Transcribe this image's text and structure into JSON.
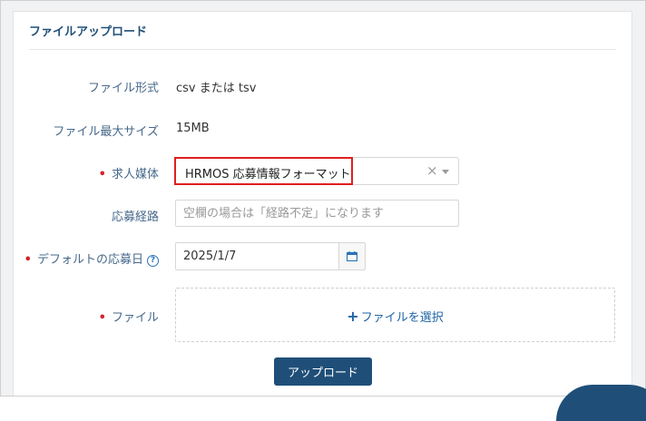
{
  "panel": {
    "title": "ファイルアップロード"
  },
  "fields": {
    "file_format": {
      "label": "ファイル形式",
      "value": "csv または tsv"
    },
    "max_size": {
      "label": "ファイル最大サイズ",
      "value": "15MB"
    },
    "media": {
      "required_mark": "•",
      "label": "求人媒体",
      "selected": "HRMOS 応募情報フォーマット",
      "clear_glyph": "×"
    },
    "route": {
      "label": "応募経路",
      "placeholder": "空欄の場合は「経路不定」になります"
    },
    "default_date": {
      "required_mark": "•",
      "label": "デフォルトの応募日",
      "value": "2025/1/7",
      "help_glyph": "?"
    },
    "file": {
      "required_mark": "•",
      "label": "ファイル",
      "plus_glyph": "+",
      "select_text": "ファイルを選択"
    }
  },
  "actions": {
    "upload_label": "アップロード"
  },
  "colors": {
    "accent": "#1f4f78",
    "required": "#d6232a",
    "highlight": "#e01e1e",
    "link": "#1e63a6"
  }
}
